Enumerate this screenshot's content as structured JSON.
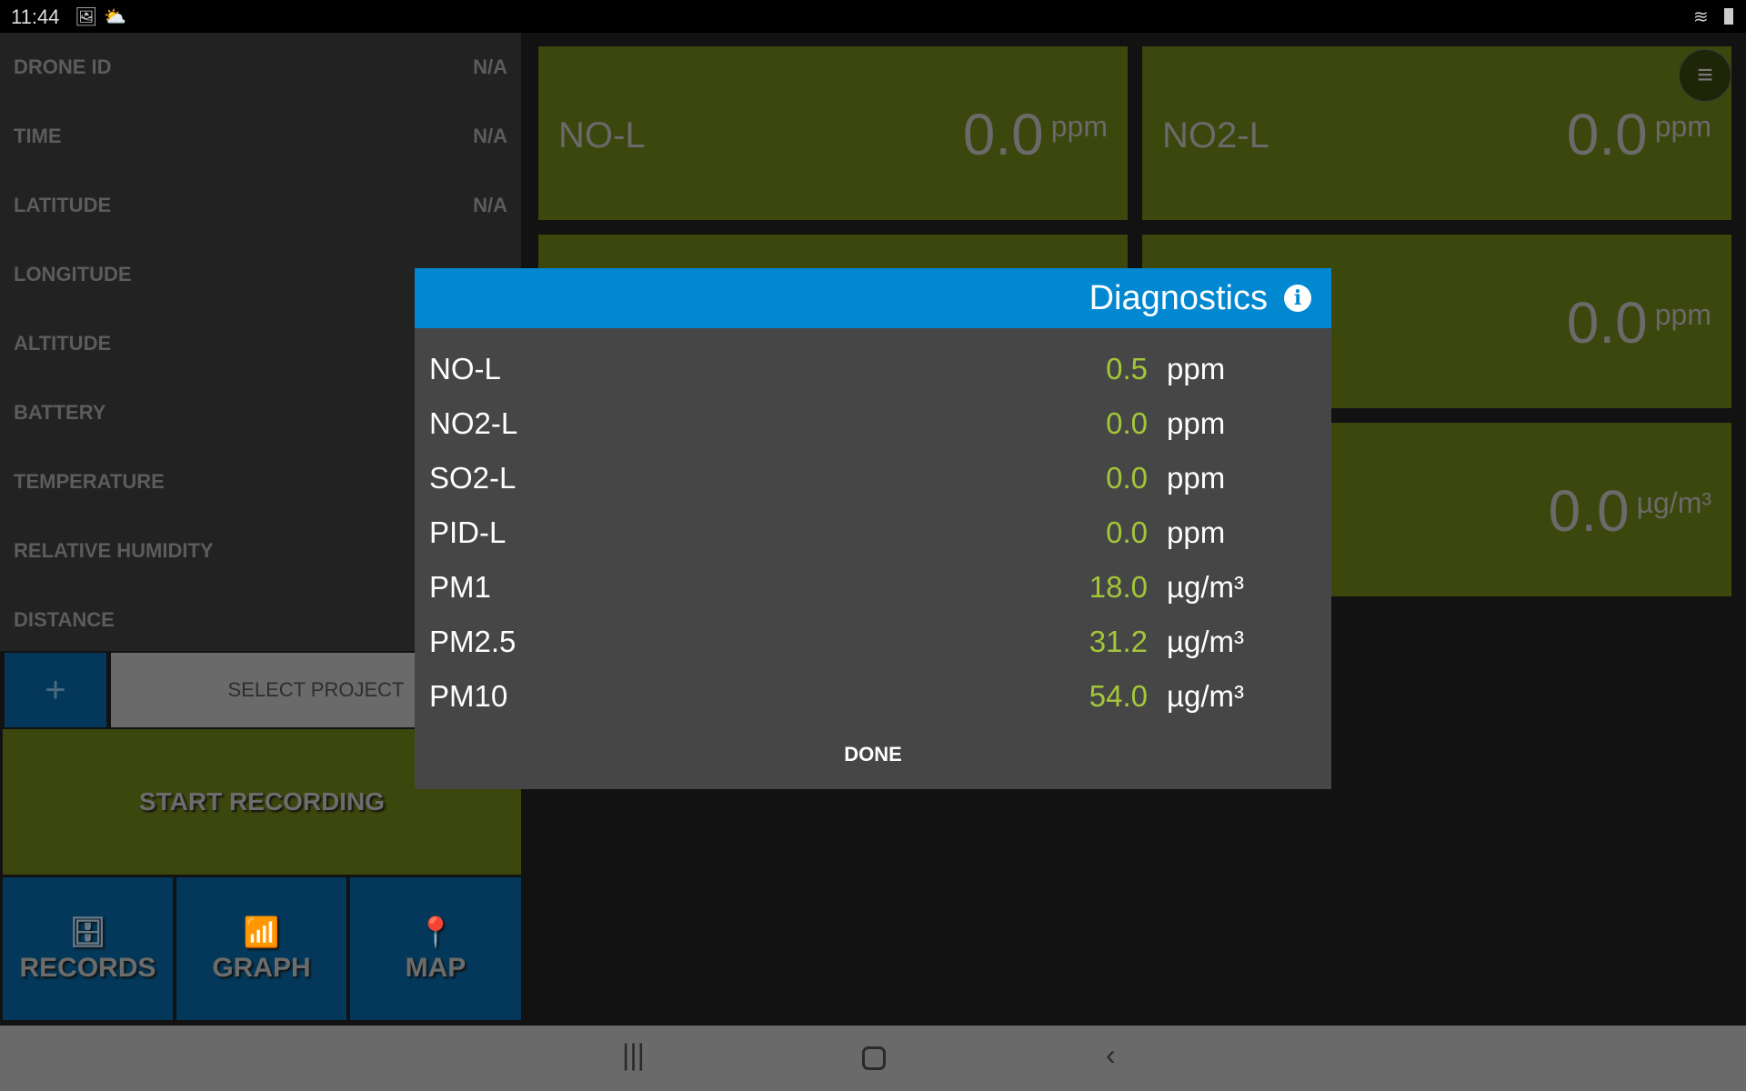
{
  "status_bar": {
    "time": "11:44",
    "icons": [
      "image-icon",
      "weather-icon",
      "wifi-icon",
      "battery-icon"
    ]
  },
  "info_panel": [
    {
      "label": "DRONE ID",
      "value": "N/A"
    },
    {
      "label": "TIME",
      "value": "N/A"
    },
    {
      "label": "LATITUDE",
      "value": "N/A"
    },
    {
      "label": "LONGITUDE",
      "value": ""
    },
    {
      "label": "ALTITUDE",
      "value": ""
    },
    {
      "label": "BATTERY",
      "value": ""
    },
    {
      "label": "TEMPERATURE",
      "value": ""
    },
    {
      "label": "RELATIVE HUMIDITY",
      "value": ""
    },
    {
      "label": "DISTANCE",
      "value": ""
    }
  ],
  "project": {
    "add_label": "+",
    "select_label": "SELECT PROJECT"
  },
  "start_recording": "START RECORDING",
  "nav_buttons": [
    {
      "label": "RECORDS",
      "icon": "records-icon"
    },
    {
      "label": "GRAPH",
      "icon": "graph-icon"
    },
    {
      "label": "MAP",
      "icon": "map-pin-icon"
    }
  ],
  "tiles": [
    {
      "name": "NO-L",
      "value": "0.0",
      "unit": "ppm"
    },
    {
      "name": "NO2-L",
      "value": "0.0",
      "unit": "ppm"
    },
    {
      "name": "",
      "value": "",
      "unit": ""
    },
    {
      "name": "",
      "value": "0.0",
      "unit": "ppm"
    },
    {
      "name": "",
      "value": "",
      "unit": ""
    },
    {
      "name": "",
      "value": "0.0",
      "unit": "µg/m³"
    }
  ],
  "dialog": {
    "title": "Diagnostics",
    "rows": [
      {
        "label": "NO-L",
        "value": "0.5",
        "unit": "ppm"
      },
      {
        "label": "NO2-L",
        "value": "0.0",
        "unit": "ppm"
      },
      {
        "label": "SO2-L",
        "value": "0.0",
        "unit": "ppm"
      },
      {
        "label": "PID-L",
        "value": "0.0",
        "unit": "ppm"
      },
      {
        "label": "PM1",
        "value": "18.0",
        "unit": "µg/m³"
      },
      {
        "label": "PM2.5",
        "value": "31.2",
        "unit": "µg/m³"
      },
      {
        "label": "PM10",
        "value": "54.0",
        "unit": "µg/m³"
      }
    ],
    "done_label": "DONE"
  },
  "colors": {
    "tile": "#3b470c",
    "dialog_header": "#0288d1",
    "value": "#a4c639",
    "nav_button": "#03385a"
  }
}
